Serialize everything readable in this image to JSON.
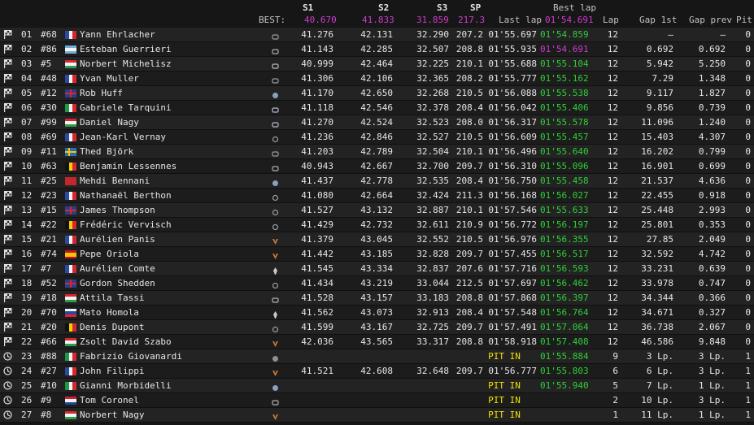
{
  "header": {
    "s1": "S1",
    "s2": "S2",
    "s3": "S3",
    "sp": "SP",
    "best_lap_top": "Best lap",
    "best_label": "BEST:",
    "best_s1": "40.670",
    "best_s2": "41.833",
    "best_s3": "31.859",
    "best_sp": "217.3",
    "last_lap": "Last lap",
    "best_lap": "01'54.691",
    "lap": "Lap",
    "gap1": "Gap 1st",
    "gapprev": "Gap prev",
    "pit": "Pit"
  },
  "colors": {
    "purple": "#cc3ccc",
    "green": "#2fcf36",
    "pit_in": "#f0e000"
  },
  "rows": [
    {
      "pos": "01",
      "num": "#68",
      "name": "Yann Ehrlacher",
      "flag": "fr",
      "brand": "lynk",
      "s1": "41.276",
      "s2": "42.131",
      "s3": "32.290",
      "sp": "207.2",
      "last": "01'55.697",
      "best": "01'54.859",
      "lap": "12",
      "gap1": "–",
      "gapprev": "–",
      "pit": "0",
      "status": "flag"
    },
    {
      "pos": "02",
      "num": "#86",
      "name": "Esteban Guerrieri",
      "flag": "ar",
      "brand": "honda",
      "s1": "41.143",
      "s2": "42.285",
      "s3": "32.507",
      "sp": "208.8",
      "last": "01'55.935",
      "best": "01'54.691",
      "best_purple": true,
      "lap": "12",
      "gap1": "0.692",
      "gapprev": "0.692",
      "pit": "0",
      "status": "flag"
    },
    {
      "pos": "03",
      "num": "#5",
      "name": "Norbert Michelisz",
      "flag": "hu",
      "brand": "hyundai",
      "s1": "40.999",
      "s2": "42.464",
      "s3": "32.225",
      "sp": "210.1",
      "last": "01'55.688",
      "best": "01'55.104",
      "lap": "12",
      "gap1": "5.942",
      "gapprev": "5.250",
      "pit": "0",
      "status": "flag"
    },
    {
      "pos": "04",
      "num": "#48",
      "name": "Yvan Muller",
      "flag": "fr",
      "brand": "lynk",
      "s1": "41.306",
      "s2": "42.106",
      "s3": "32.365",
      "sp": "208.2",
      "last": "01'55.777",
      "best": "01'55.162",
      "lap": "12",
      "gap1": "7.29",
      "gapprev": "1.348",
      "pit": "0",
      "status": "flag"
    },
    {
      "pos": "05",
      "num": "#12",
      "name": "Rob Huff",
      "flag": "gb",
      "brand": "vw",
      "s1": "41.170",
      "s2": "42.650",
      "s3": "32.268",
      "sp": "210.5",
      "last": "01'56.088",
      "best": "01'55.538",
      "lap": "12",
      "gap1": "9.117",
      "gapprev": "1.827",
      "pit": "0",
      "status": "flag"
    },
    {
      "pos": "06",
      "num": "#30",
      "name": "Gabriele Tarquini",
      "flag": "it",
      "brand": "hyundai",
      "s1": "41.118",
      "s2": "42.546",
      "s3": "32.378",
      "sp": "208.4",
      "last": "01'56.042",
      "best": "01'55.406",
      "lap": "12",
      "gap1": "9.856",
      "gapprev": "0.739",
      "pit": "0",
      "status": "flag"
    },
    {
      "pos": "07",
      "num": "#99",
      "name": "Daniel Nagy",
      "flag": "hu",
      "brand": "hyundai",
      "s1": "41.270",
      "s2": "42.524",
      "s3": "32.523",
      "sp": "208.0",
      "last": "01'56.317",
      "best": "01'55.578",
      "lap": "12",
      "gap1": "11.096",
      "gapprev": "1.240",
      "pit": "0",
      "status": "flag"
    },
    {
      "pos": "08",
      "num": "#69",
      "name": "Jean-Karl Vernay",
      "flag": "fr",
      "brand": "audi",
      "s1": "41.236",
      "s2": "42.846",
      "s3": "32.527",
      "sp": "210.5",
      "last": "01'56.609",
      "best": "01'55.457",
      "lap": "12",
      "gap1": "15.403",
      "gapprev": "4.307",
      "pit": "0",
      "status": "flag"
    },
    {
      "pos": "09",
      "num": "#11",
      "name": "Thed Björk",
      "flag": "se",
      "brand": "lynk",
      "s1": "41.203",
      "s2": "42.789",
      "s3": "32.504",
      "sp": "210.1",
      "last": "01'56.496",
      "best": "01'55.640",
      "lap": "12",
      "gap1": "16.202",
      "gapprev": "0.799",
      "pit": "0",
      "status": "flag"
    },
    {
      "pos": "10",
      "num": "#63",
      "name": "Benjamin Lessennes",
      "flag": "be",
      "brand": "honda",
      "s1": "40.943",
      "s2": "42.667",
      "s3": "32.700",
      "sp": "209.7",
      "last": "01'56.310",
      "best": "01'55.096",
      "lap": "12",
      "gap1": "16.901",
      "gapprev": "0.699",
      "pit": "0",
      "status": "flag"
    },
    {
      "pos": "11",
      "num": "#25",
      "name": "Mehdi Bennani",
      "flag": "ma",
      "brand": "vw",
      "s1": "41.437",
      "s2": "42.778",
      "s3": "32.535",
      "sp": "208.4",
      "last": "01'56.750",
      "best": "01'55.458",
      "lap": "12",
      "gap1": "21.537",
      "gapprev": "4.636",
      "pit": "0",
      "status": "flag"
    },
    {
      "pos": "12",
      "num": "#23",
      "name": "Nathanaël Berthon",
      "flag": "fr",
      "brand": "audi",
      "s1": "41.080",
      "s2": "42.664",
      "s3": "32.424",
      "sp": "211.3",
      "last": "01'56.168",
      "best": "01'56.027",
      "lap": "12",
      "gap1": "22.455",
      "gapprev": "0.918",
      "pit": "0",
      "status": "flag"
    },
    {
      "pos": "13",
      "num": "#15",
      "name": "James Thompson",
      "flag": "gb",
      "brand": "audi",
      "s1": "41.527",
      "s2": "43.132",
      "s3": "32.887",
      "sp": "210.1",
      "last": "01'57.546",
      "best": "01'55.633",
      "lap": "12",
      "gap1": "25.448",
      "gapprev": "2.993",
      "pit": "0",
      "status": "flag"
    },
    {
      "pos": "14",
      "num": "#22",
      "name": "Frédéric Vervisch",
      "flag": "be",
      "brand": "audi",
      "s1": "41.429",
      "s2": "42.732",
      "s3": "32.611",
      "sp": "210.9",
      "last": "01'56.772",
      "best": "01'56.197",
      "lap": "12",
      "gap1": "25.801",
      "gapprev": "0.353",
      "pit": "0",
      "status": "flag"
    },
    {
      "pos": "15",
      "num": "#21",
      "name": "Aurélien Panis",
      "flag": "fr",
      "brand": "cupra",
      "s1": "41.379",
      "s2": "43.045",
      "s3": "32.552",
      "sp": "210.5",
      "last": "01'56.976",
      "best": "01'56.355",
      "lap": "12",
      "gap1": "27.85",
      "gapprev": "2.049",
      "pit": "0",
      "status": "flag"
    },
    {
      "pos": "16",
      "num": "#74",
      "name": "Pepe Oriola",
      "flag": "es",
      "brand": "cupra",
      "s1": "41.442",
      "s2": "43.185",
      "s3": "32.828",
      "sp": "209.7",
      "last": "01'57.455",
      "best": "01'56.517",
      "lap": "12",
      "gap1": "32.592",
      "gapprev": "4.742",
      "pit": "0",
      "status": "flag"
    },
    {
      "pos": "17",
      "num": "#7",
      "name": "Aurélien Comte",
      "flag": "fr",
      "brand": "peugeot",
      "s1": "41.545",
      "s2": "43.334",
      "s3": "32.837",
      "sp": "207.6",
      "last": "01'57.716",
      "best": "01'56.593",
      "lap": "12",
      "gap1": "33.231",
      "gapprev": "0.639",
      "pit": "0",
      "status": "flag"
    },
    {
      "pos": "18",
      "num": "#52",
      "name": "Gordon Shedden",
      "flag": "gb",
      "brand": "audi",
      "s1": "41.434",
      "s2": "43.219",
      "s3": "33.044",
      "sp": "212.5",
      "last": "01'57.697",
      "best": "01'56.462",
      "lap": "12",
      "gap1": "33.978",
      "gapprev": "0.747",
      "pit": "0",
      "status": "flag"
    },
    {
      "pos": "19",
      "num": "#18",
      "name": "Attila Tassi",
      "flag": "hu",
      "brand": "honda",
      "s1": "41.528",
      "s2": "43.157",
      "s3": "33.183",
      "sp": "208.8",
      "last": "01'57.868",
      "best": "01'56.397",
      "lap": "12",
      "gap1": "34.344",
      "gapprev": "0.366",
      "pit": "0",
      "status": "flag"
    },
    {
      "pos": "20",
      "num": "#70",
      "name": "Mato Homola",
      "flag": "sk",
      "brand": "peugeot",
      "s1": "41.562",
      "s2": "43.073",
      "s3": "32.913",
      "sp": "208.4",
      "last": "01'57.548",
      "best": "01'56.764",
      "lap": "12",
      "gap1": "34.671",
      "gapprev": "0.327",
      "pit": "0",
      "status": "flag"
    },
    {
      "pos": "21",
      "num": "#20",
      "name": "Denis Dupont",
      "flag": "be",
      "brand": "audi",
      "s1": "41.599",
      "s2": "43.167",
      "s3": "32.725",
      "sp": "209.7",
      "last": "01'57.491",
      "best": "01'57.064",
      "lap": "12",
      "gap1": "36.738",
      "gapprev": "2.067",
      "pit": "0",
      "status": "flag"
    },
    {
      "pos": "22",
      "num": "#66",
      "name": "Zsolt David Szabo",
      "flag": "hu",
      "brand": "cupra",
      "s1": "42.036",
      "s2": "43.565",
      "s3": "33.317",
      "sp": "208.8",
      "last": "01'58.918",
      "best": "01'57.408",
      "lap": "12",
      "gap1": "46.586",
      "gapprev": "9.848",
      "pit": "0",
      "status": "flag"
    },
    {
      "pos": "23",
      "num": "#88",
      "name": "Fabrizio Giovanardi",
      "flag": "it",
      "brand": "alfa",
      "s1": "",
      "s2": "",
      "s3": "",
      "sp": "",
      "last": "PIT IN",
      "pitin": true,
      "best": "01'55.884",
      "lap": "9",
      "gap1": "3 Lp.",
      "gapprev": "3 Lp.",
      "pit": "1",
      "status": "clock"
    },
    {
      "pos": "24",
      "num": "#27",
      "name": "John Filippi",
      "flag": "fr",
      "brand": "cupra",
      "s1": "41.521",
      "s2": "42.608",
      "s3": "32.648",
      "sp": "209.7",
      "last": "01'56.777",
      "best": "01'55.803",
      "lap": "6",
      "gap1": "6 Lp.",
      "gapprev": "3 Lp.",
      "pit": "1",
      "status": "clock"
    },
    {
      "pos": "25",
      "num": "#10",
      "name": "Gianni Morbidelli",
      "flag": "it",
      "brand": "vw",
      "s1": "",
      "s2": "",
      "s3": "",
      "sp": "",
      "last": "PIT IN",
      "pitin": true,
      "best": "01'55.940",
      "lap": "5",
      "gap1": "7 Lp.",
      "gapprev": "1 Lp.",
      "pit": "1",
      "status": "clock"
    },
    {
      "pos": "26",
      "num": "#9",
      "name": "Tom Coronel",
      "flag": "nl",
      "brand": "honda",
      "s1": "",
      "s2": "",
      "s3": "",
      "sp": "",
      "last": "PIT IN",
      "pitin": true,
      "best": "",
      "lap": "2",
      "gap1": "10 Lp.",
      "gapprev": "3 Lp.",
      "pit": "1",
      "status": "clock"
    },
    {
      "pos": "27",
      "num": "#8",
      "name": "Norbert Nagy",
      "flag": "hu",
      "brand": "cupra",
      "s1": "",
      "s2": "",
      "s3": "",
      "sp": "",
      "last": "PIT IN",
      "pitin": true,
      "best": "",
      "lap": "1",
      "gap1": "11 Lp.",
      "gapprev": "1 Lp.",
      "pit": "1",
      "status": "clock"
    }
  ]
}
